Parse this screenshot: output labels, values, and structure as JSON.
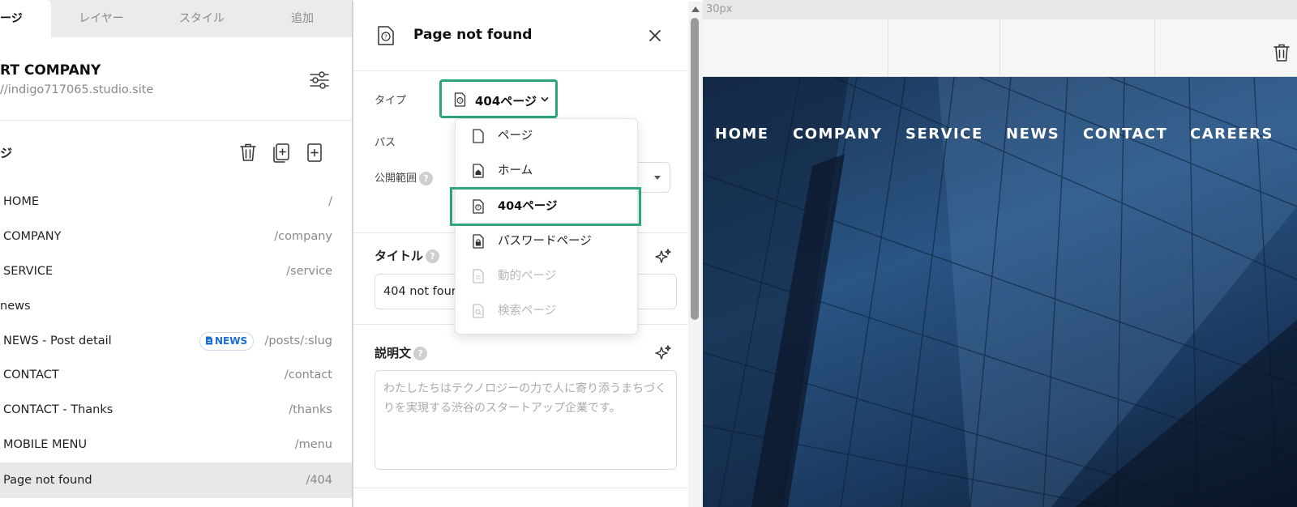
{
  "left_panel": {
    "tabs": [
      {
        "label": "ージ",
        "active": true
      },
      {
        "label": "レイヤー",
        "active": false
      },
      {
        "label": "スタイル",
        "active": false
      },
      {
        "label": "追加",
        "active": false
      }
    ],
    "site_name": "RT COMPANY",
    "site_url": "//indigo717065.studio.site",
    "pages_heading": "ジ",
    "pages": [
      {
        "name": "HOME",
        "path": "/"
      },
      {
        "name": "COMPANY",
        "path": "/company"
      },
      {
        "name": "SERVICE",
        "path": "/service"
      },
      {
        "name": "news",
        "path": ""
      },
      {
        "name": "NEWS - Post detail",
        "path": "/posts/:slug",
        "badge": "NEWS"
      },
      {
        "name": "CONTACT",
        "path": "/contact"
      },
      {
        "name": "CONTACT - Thanks",
        "path": "/thanks"
      },
      {
        "name": "MOBILE MENU",
        "path": "/menu"
      },
      {
        "name": "Page not found",
        "path": "/404",
        "selected": true
      }
    ]
  },
  "modal": {
    "title": "Page not found",
    "type_label": "タイプ",
    "type_value": "404ページ",
    "path_label": "パス",
    "visibility_label": "公開範囲",
    "title_section_label": "タイトル",
    "title_value": "404 not four",
    "description_label": "説明文",
    "description_placeholder": "わたしたちはテクノロジーの力で人に寄り添うまちづくりを実現する渋谷のスタートアップ企業です。"
  },
  "dropdown": {
    "items": [
      {
        "label": "ページ",
        "icon": "page-icon",
        "state": "normal"
      },
      {
        "label": "ホーム",
        "icon": "home-page-icon",
        "state": "normal"
      },
      {
        "label": "404ページ",
        "icon": "404-page-icon",
        "state": "selected"
      },
      {
        "label": "パスワードページ",
        "icon": "lock-page-icon",
        "state": "normal"
      },
      {
        "label": "動的ページ",
        "icon": "dynamic-page-icon",
        "state": "disabled"
      },
      {
        "label": "検索ページ",
        "icon": "search-page-icon",
        "state": "disabled"
      }
    ]
  },
  "canvas": {
    "ruler_label": "30px",
    "nav": [
      "HOME",
      "COMPANY",
      "SERVICE",
      "NEWS",
      "CONTACT",
      "CAREERS"
    ]
  },
  "colors": {
    "highlight": "#2aa57c",
    "badge_text": "#1a6fd6",
    "hero_dark": "#0e1d33",
    "hero_mid": "#2a5584"
  }
}
